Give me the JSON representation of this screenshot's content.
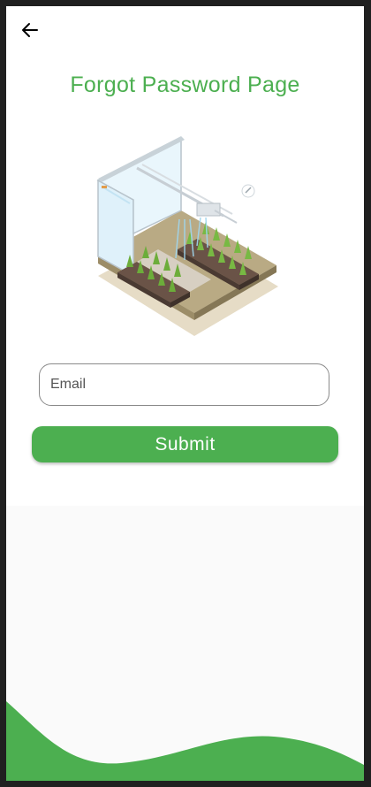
{
  "header": {
    "back_icon": "arrow-left-icon",
    "title": "Forgot Password Page"
  },
  "illustration": {
    "icon": "greenhouse-irrigation-illustration"
  },
  "form": {
    "email_placeholder": "Email",
    "email_value": "",
    "submit_label": "Submit"
  },
  "colors": {
    "accent": "#4caf50",
    "background": "#ffffff",
    "bottom_background": "#fafafa",
    "frame": "#202020"
  }
}
